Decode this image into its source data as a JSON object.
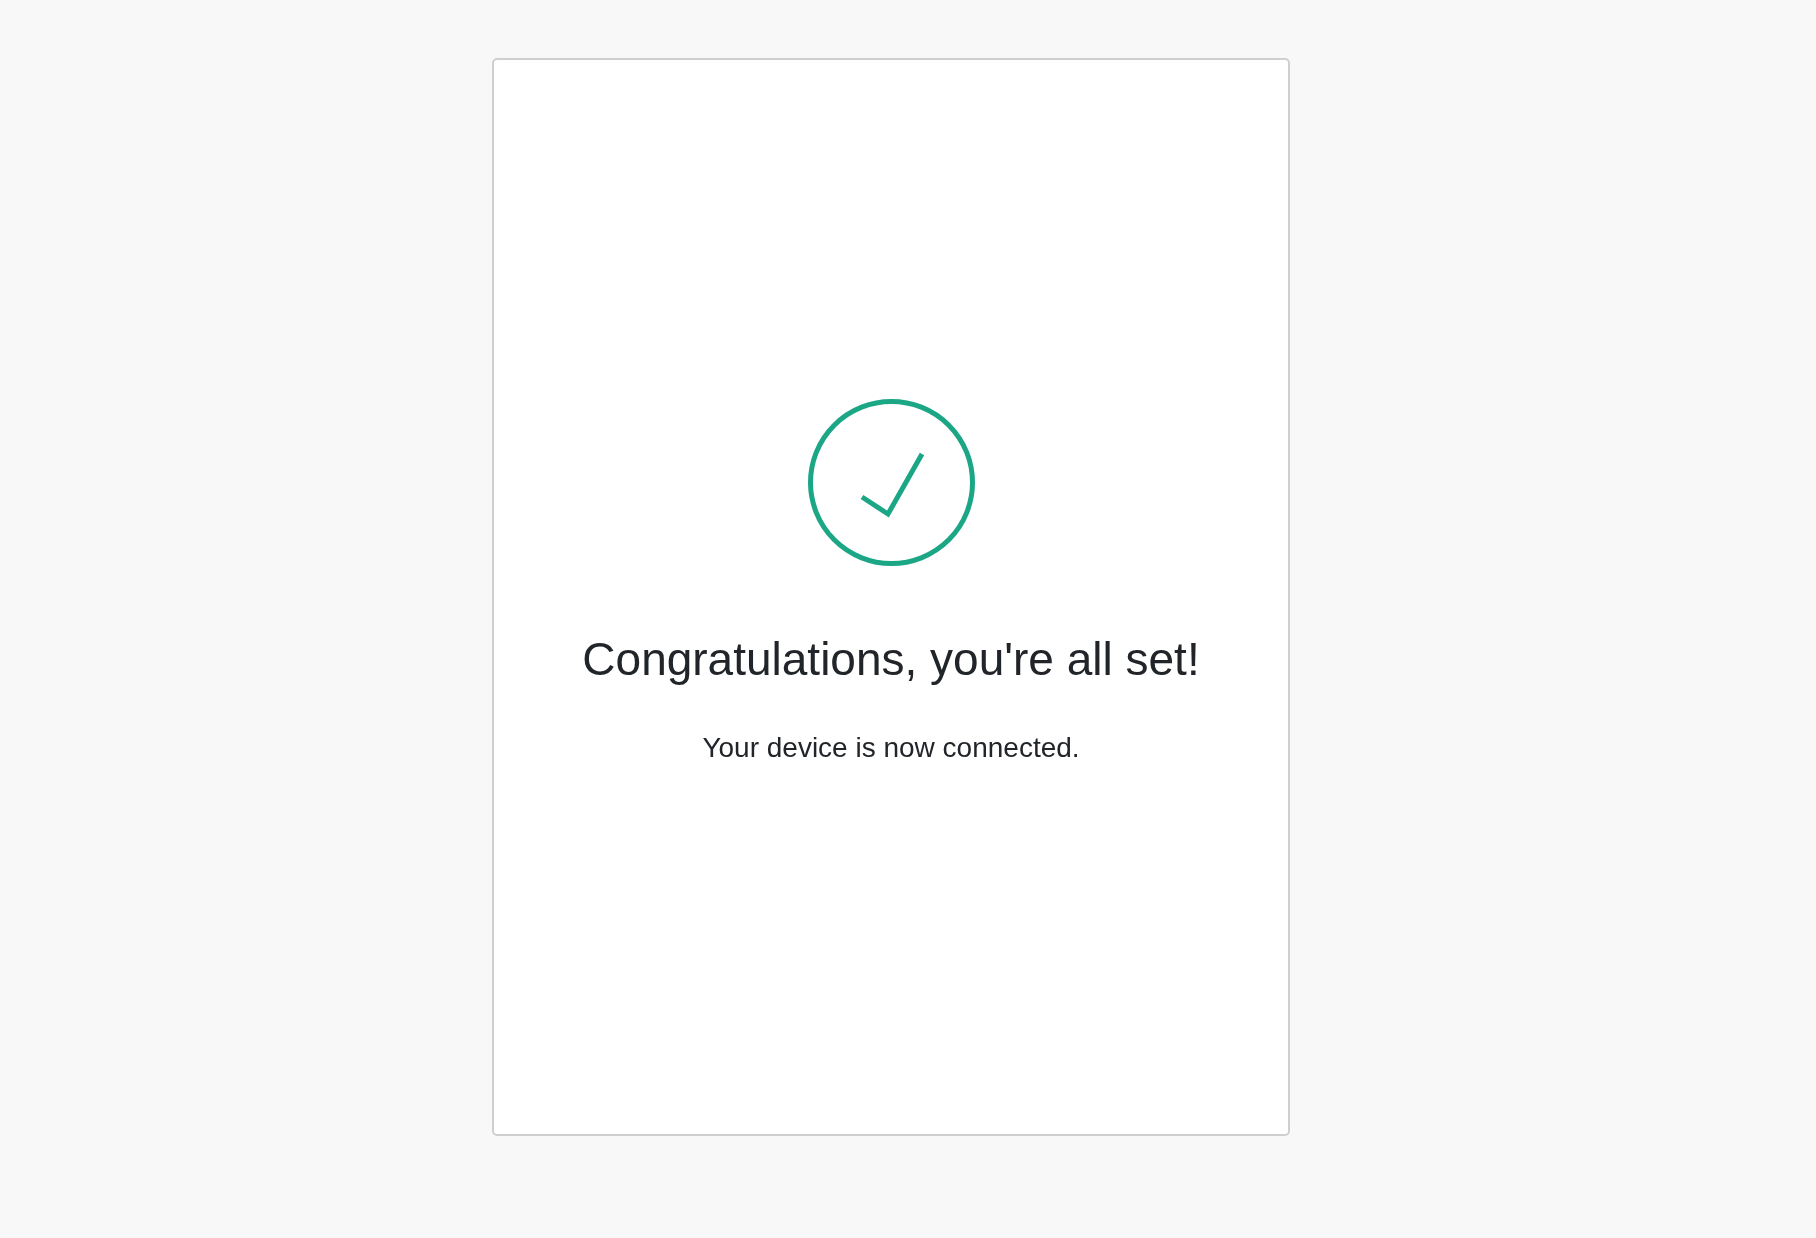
{
  "title": "Congratulations, you're all set!",
  "message": "Your device is now connected."
}
